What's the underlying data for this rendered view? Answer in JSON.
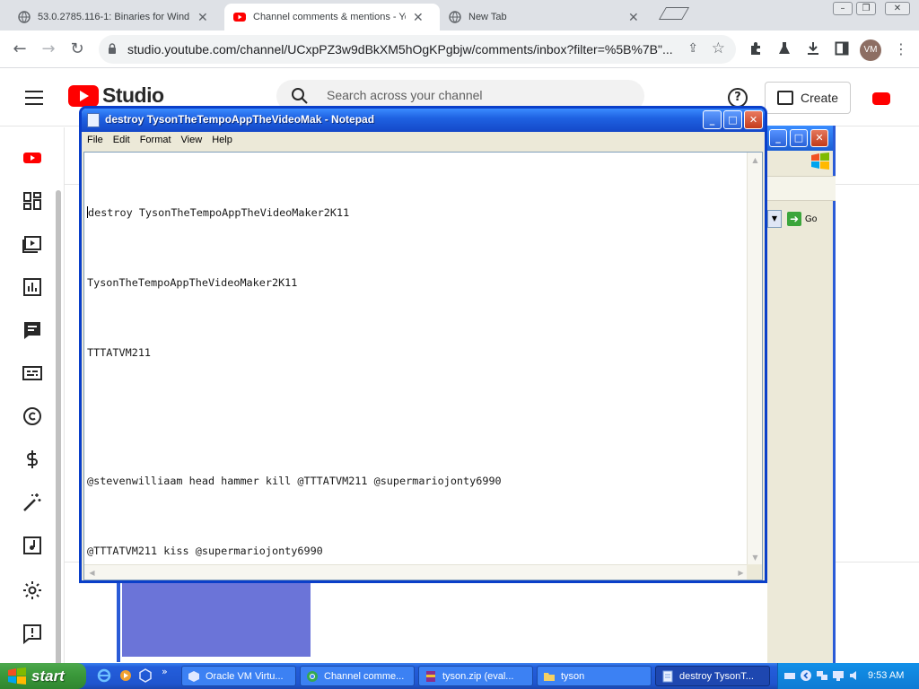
{
  "browser": {
    "tabs": [
      {
        "title": "53.0.2785.116-1: Binaries for Wind",
        "active": false
      },
      {
        "title": "Channel comments & mentions - Yo",
        "active": true
      },
      {
        "title": "New Tab",
        "active": false
      }
    ],
    "url": "studio.youtube.com/channel/UCxpPZ3w9dBkXM5hOgKPgbjw/comments/inbox?filter=%5B%7B\"...",
    "profile_initials": "VM"
  },
  "studio": {
    "brand": "Studio",
    "search_placeholder": "Search across your channel",
    "create_label": "Create",
    "help_label": "?",
    "sidebar_icons": [
      "channel-icon",
      "dashboard-icon",
      "content-icon",
      "analytics-icon",
      "comments-icon",
      "subtitles-icon",
      "copyright-icon",
      "earn-icon",
      "customization-icon",
      "audio-library-icon",
      "settings-icon",
      "feedback-icon"
    ]
  },
  "behind_window": {
    "go_label": "Go"
  },
  "notepad": {
    "title": "destroy TysonTheTempoAppTheVideoMak - Notepad",
    "menu": [
      "File",
      "Edit",
      "Format",
      "View",
      "Help"
    ],
    "lines": [
      "destroy TysonTheTempoAppTheVideoMaker2K11",
      "TysonTheTempoAppTheVideoMaker2K11",
      "TTTATVM211",
      "",
      "@stevenwilliaam head hammer kill @TTTATVM211 @supermariojonty6990",
      "@TTTATVM211 kiss @supermariojonty6990"
    ]
  },
  "taskbar": {
    "start_label": "start",
    "tasks": [
      {
        "label": "Oracle VM Virtu...",
        "active": false
      },
      {
        "label": "Channel comme...",
        "active": false
      },
      {
        "label": "tyson.zip (eval...",
        "active": false
      },
      {
        "label": "tyson",
        "active": false
      },
      {
        "label": "destroy TysonT...",
        "active": true
      }
    ],
    "clock": "9:53 AM"
  },
  "colors": {
    "xp_blue": "#245edb",
    "xp_start_green": "#3c9a3c",
    "youtube_red": "#ff0000"
  }
}
